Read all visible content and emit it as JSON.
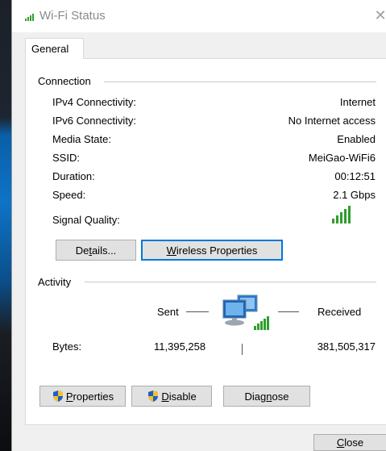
{
  "window": {
    "title": "Wi-Fi Status"
  },
  "tabs": [
    {
      "label": "General"
    }
  ],
  "connection": {
    "label": "Connection",
    "rows": [
      {
        "label": "IPv4 Connectivity:",
        "value": "Internet"
      },
      {
        "label": "IPv6 Connectivity:",
        "value": "No Internet access"
      },
      {
        "label": "Media State:",
        "value": "Enabled"
      },
      {
        "label": "SSID:",
        "value": "MeiGao-WiFi6"
      },
      {
        "label": "Duration:",
        "value": "00:12:51"
      },
      {
        "label": "Speed:",
        "value": "2.1 Gbps"
      }
    ],
    "signal_label": "Signal Quality:",
    "signal_bars": 5,
    "details_button": {
      "pre": "De",
      "ul": "t",
      "post": "ails..."
    },
    "wireless_button": {
      "pre": "",
      "ul": "W",
      "post": "ireless Properties"
    }
  },
  "activity": {
    "label": "Activity",
    "sent_label": "Sent",
    "received_label": "Received",
    "bytes_label": "Bytes:",
    "bytes_sent": "11,395,258",
    "bytes_received": "381,505,317"
  },
  "buttons": {
    "properties": {
      "pre": "",
      "ul": "P",
      "post": "roperties"
    },
    "disable": {
      "pre": "",
      "ul": "D",
      "post": "isable"
    },
    "diagnose": {
      "pre": "Diag",
      "ul": "n",
      "post": "ose"
    },
    "close": {
      "pre": "",
      "ul": "C",
      "post": "lose"
    }
  },
  "colors": {
    "accent": "#0078d7",
    "signal": "#2e9e2e"
  }
}
